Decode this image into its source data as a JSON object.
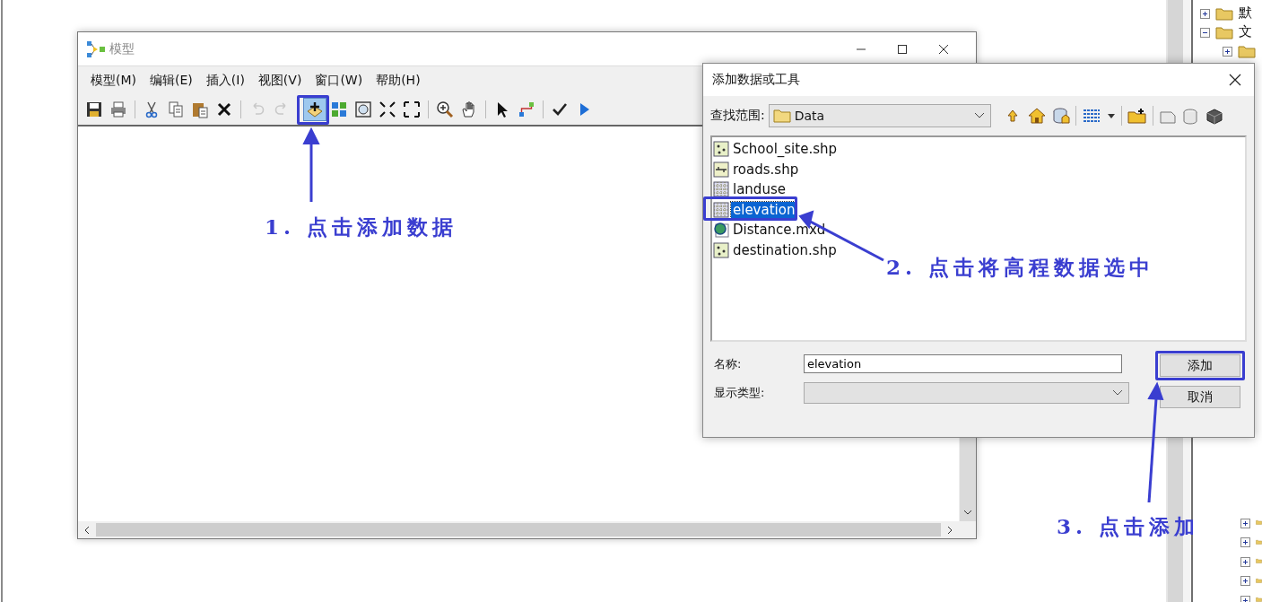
{
  "model_window": {
    "title": "模型",
    "menu": [
      {
        "label": "模型(M)"
      },
      {
        "label": "编辑(E)"
      },
      {
        "label": "插入(I)"
      },
      {
        "label": "视图(V)"
      },
      {
        "label": "窗口(W)"
      },
      {
        "label": "帮助(H)"
      }
    ],
    "toolbar": [
      {
        "kind": "save",
        "disabled": false,
        "highlighted": false
      },
      {
        "kind": "print",
        "disabled": false,
        "highlighted": false
      },
      {
        "kind": "sep"
      },
      {
        "kind": "cut",
        "disabled": false,
        "highlighted": false
      },
      {
        "kind": "copy",
        "disabled": false,
        "highlighted": false
      },
      {
        "kind": "paste",
        "disabled": false,
        "highlighted": false
      },
      {
        "kind": "delete",
        "disabled": false,
        "highlighted": false
      },
      {
        "kind": "sep"
      },
      {
        "kind": "undo",
        "disabled": true,
        "highlighted": false
      },
      {
        "kind": "redo",
        "disabled": true,
        "highlighted": false
      },
      {
        "kind": "sep"
      },
      {
        "kind": "add",
        "disabled": false,
        "highlighted": true
      },
      {
        "kind": "tiles",
        "disabled": false,
        "highlighted": false
      },
      {
        "kind": "extent",
        "disabled": false,
        "highlighted": false
      },
      {
        "kind": "shrink",
        "disabled": false,
        "highlighted": false
      },
      {
        "kind": "expand",
        "disabled": false,
        "highlighted": false
      },
      {
        "kind": "sep"
      },
      {
        "kind": "zoom",
        "disabled": false,
        "highlighted": false
      },
      {
        "kind": "pan",
        "disabled": false,
        "highlighted": false
      },
      {
        "kind": "sep"
      },
      {
        "kind": "pointer",
        "disabled": false,
        "highlighted": false
      },
      {
        "kind": "connect",
        "disabled": false,
        "highlighted": false
      },
      {
        "kind": "sep"
      },
      {
        "kind": "check",
        "disabled": false,
        "highlighted": false
      },
      {
        "kind": "run",
        "disabled": false,
        "highlighted": false
      }
    ]
  },
  "dialog": {
    "title": "添加数据或工具",
    "look_in_label": "查找范围:",
    "look_in_value": "Data",
    "files": [
      {
        "name": "School_site.shp",
        "kind": "point",
        "selected": false
      },
      {
        "name": "roads.shp",
        "kind": "line",
        "selected": false
      },
      {
        "name": "landuse",
        "kind": "raster",
        "selected": false
      },
      {
        "name": "elevation",
        "kind": "raster",
        "selected": true
      },
      {
        "name": "Distance.mxd",
        "kind": "map",
        "selected": false
      },
      {
        "name": "destination.shp",
        "kind": "point",
        "selected": false
      }
    ],
    "name_label": "名称:",
    "name_value": "elevation",
    "type_label": "显示类型:",
    "type_disabled": true,
    "buttons": [
      {
        "label": "添加"
      },
      {
        "label": "取消"
      }
    ]
  },
  "tree": {
    "top": [
      {
        "label": "默",
        "expanded": false
      },
      {
        "label": "文",
        "expanded": true
      },
      {
        "expanded": false
      }
    ],
    "bottom": [
      {
        "expanded": false
      },
      {
        "expanded": false
      },
      {
        "expanded": false
      },
      {
        "expanded": false
      },
      {
        "expanded": false
      }
    ]
  },
  "annotations": [
    {
      "text": "1. 点击添加数据"
    },
    {
      "text": "2. 点击将高程数据选中"
    },
    {
      "text": "3. 点击添加"
    }
  ]
}
